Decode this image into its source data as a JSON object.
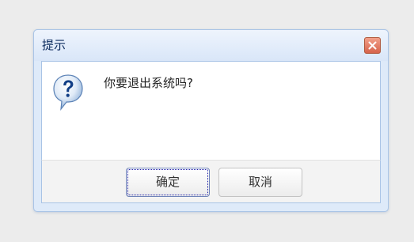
{
  "dialog": {
    "title": "提示",
    "close_icon": "close-icon",
    "message_icon": "question-icon",
    "message": "你要退出系统吗?",
    "buttons": {
      "ok_label": "确定",
      "cancel_label": "取消"
    }
  },
  "colors": {
    "page_background": "#ececec",
    "title_text": "#0e2d5f",
    "frame_border": "#a9c4e6",
    "close_button": "#d6624a",
    "focus_ring": "#1a1aa8"
  }
}
